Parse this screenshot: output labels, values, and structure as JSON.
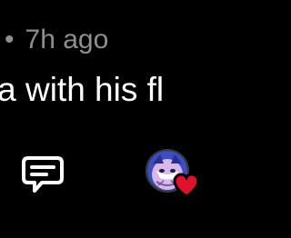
{
  "post": {
    "meta_separator": "•",
    "timestamp": "7h ago",
    "body_text": "America with his fl"
  },
  "actions": {
    "comment_icon": "chat-bubble-icon",
    "reaction_avatar": "avatar",
    "reaction_icon": "heart-icon"
  },
  "colors": {
    "background": "#000000",
    "meta_text": "#8e8e93",
    "body_text": "#ffffff",
    "icon_stroke": "#ffffff",
    "heart": "#e0112b",
    "avatar_bg": "#3b4dbf"
  }
}
